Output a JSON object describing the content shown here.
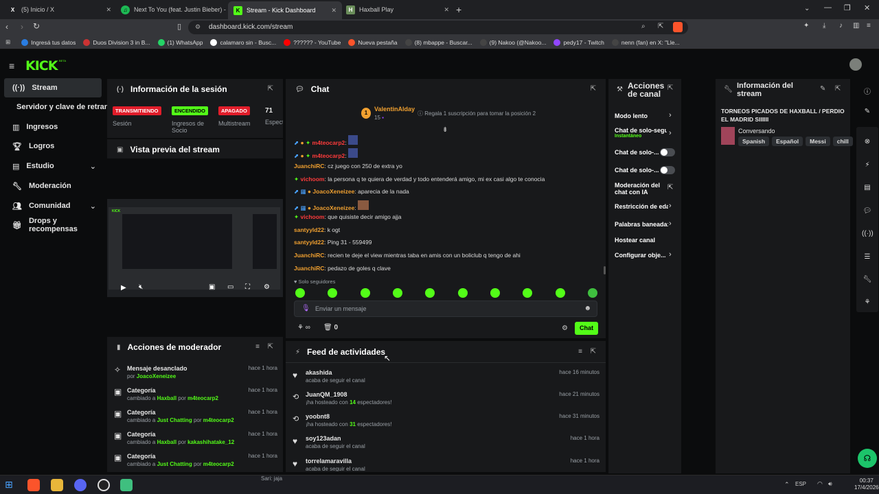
{
  "browser": {
    "tabs": [
      {
        "title": "(5) Inicio / X",
        "icon": "X"
      },
      {
        "title": "Next To You (feat. Justin Bieber) -",
        "icon": "♫"
      },
      {
        "title": "Stream - Kick Dashboard",
        "icon": "K"
      },
      {
        "title": "Haxball Play",
        "icon": "H"
      }
    ],
    "url": "dashboard.kick.com/stream",
    "bookmarks": [
      "Ingresá tus datos",
      "Duos Division 3 in B...",
      "(1) WhatsApp",
      "calamaro sin - Busc...",
      "?????? - YouTube",
      "Nueva pestaña",
      "(8) mbappe - Buscar...",
      "(9) Nakoo (@Nakoo...",
      "pedy17 - Twitch",
      "nenn (fan) en X: \"Lle..."
    ]
  },
  "kick": {
    "logo": "KICK",
    "beta": "BETA"
  },
  "sidebar": {
    "items": [
      {
        "label": "Stream",
        "icon": "broadcast-icon"
      },
      {
        "label": "Servidor y clave de retransm",
        "icon": ""
      },
      {
        "label": "Ingresos",
        "icon": "chart-icon"
      },
      {
        "label": "Logros",
        "icon": "trophy-icon"
      },
      {
        "label": "Estudio",
        "icon": "studio-icon"
      },
      {
        "label": "Moderación",
        "icon": "wrench-icon"
      },
      {
        "label": "Comunidad",
        "icon": "community-icon"
      },
      {
        "label": "Drops y recompensas",
        "icon": "gift-icon"
      }
    ]
  },
  "session": {
    "title": "Información de la sesión",
    "stats": [
      {
        "badge": "TRANSMITIENDO",
        "label": "Sesión",
        "color": "#e11d2a"
      },
      {
        "badge": "ENCENDIDO",
        "label": "Ingresos de Socio",
        "color": "#53fc18"
      },
      {
        "badge": "APAGADO",
        "label": "Multistream",
        "color": "#e11d2a"
      },
      {
        "badge": "71",
        "label": "Espect"
      }
    ]
  },
  "preview": {
    "title": "Vista previa del stream"
  },
  "mod_actions": {
    "title": "Acciones de moderador",
    "items": [
      {
        "action": "Mensaje desanclado",
        "detail_prefix": "por",
        "user": "JoacoXeneizee",
        "category": "",
        "time": "hace 1 hora"
      },
      {
        "action": "Categoría",
        "detail_prefix": "cambiado a",
        "category": "Haxball",
        "by": "por",
        "user": "m4teocarp2",
        "time": "hace 1 hora"
      },
      {
        "action": "Categoría",
        "detail_prefix": "cambiado a",
        "category": "Just Chatting",
        "by": "por",
        "user": "m4teocarp2",
        "time": "hace 1 hora"
      },
      {
        "action": "Categoría",
        "detail_prefix": "cambiado a",
        "category": "Haxball",
        "by": "por",
        "user": "kakashihatake_12",
        "time": "hace 1 hora"
      },
      {
        "action": "Categoría",
        "detail_prefix": "cambiado a",
        "category": "Just Chatting",
        "by": "por",
        "user": "m4teocarp2",
        "time": "hace 1 hora"
      }
    ]
  },
  "chat": {
    "title": "Chat",
    "pinned": {
      "user": "ValentinAlday",
      "count": "15",
      "text": "Regala 1 suscripción para tomar la posición 2"
    },
    "messages": [
      {
        "user": "m4teocarp2",
        "color": "#ff3b3b",
        "text": ""
      },
      {
        "user": "m4teocarp2",
        "color": "#ff3b3b",
        "text": ""
      },
      {
        "user": "JuanchiRC",
        "color": "#f0a030",
        "text": "cz juego con 250 de extra yo"
      },
      {
        "user": "vichoom",
        "color": "#ff3b3b",
        "text": "la persona q te quiera de verdad y todo entenderá amigo, mi ex casi algo te conocia"
      },
      {
        "user": "JoacoXeneizee",
        "color": "#f0a030",
        "text": "aparecia de la nada"
      },
      {
        "user": "JoacoXeneizee",
        "color": "#f0a030",
        "text": ""
      },
      {
        "user": "vichoom",
        "color": "#ff3b3b",
        "text": "que quisiste decir amigo ajja"
      },
      {
        "user": "santyyld22",
        "color": "#f0a030",
        "text": "k ogt"
      },
      {
        "user": "santyyld22",
        "color": "#f0a030",
        "text": "Ping 31 - 559499"
      },
      {
        "user": "JuanchiRC",
        "color": "#f0a030",
        "text": "recien te deje el view mientras taba en amis con un boliclub q tengo de ahi"
      },
      {
        "user": "JuanchiRC",
        "color": "#f0a030",
        "text": "pedazo de goles q clave"
      }
    ],
    "followers_only": "Solo seguidores",
    "placeholder": "Enviar un mensaje",
    "infinite": "∞",
    "points": "0",
    "send": "Chat"
  },
  "feed": {
    "title": "Feed de actividades",
    "items": [
      {
        "user": "akashida",
        "desc": "acaba de seguir el canal",
        "time": "hace 16 minutos",
        "icon": "heart-icon"
      },
      {
        "user": "JuanQM_1908",
        "desc_prefix": "¡ha hosteado con",
        "num": "14",
        "desc_suffix": "espectadores!",
        "time": "hace 21 minutos",
        "icon": "host-icon"
      },
      {
        "user": "yoobnt8",
        "desc_prefix": "¡ha hosteado con",
        "num": "31",
        "desc_suffix": "espectadores!",
        "time": "hace 31 minutos",
        "icon": "host-icon"
      },
      {
        "user": "soy123adan",
        "desc": "acaba de seguir el canal",
        "time": "hace 1 hora",
        "icon": "heart-icon"
      },
      {
        "user": "torrelamaravilla",
        "desc": "acaba de seguir el canal",
        "time": "hace 1 hora",
        "icon": "heart-icon"
      }
    ]
  },
  "channel_actions": {
    "title_l1": "Acciones",
    "title_l2": "de canal",
    "items": [
      {
        "label": "Modo lento",
        "sub": ""
      },
      {
        "label": "Chat de solo-segu",
        "sub": "Instantáneo"
      },
      {
        "label": "Chat de solo-...",
        "sub": ""
      },
      {
        "label": "Chat de solo-...",
        "sub": ""
      },
      {
        "label": "Moderación del chat con IA",
        "sub": ""
      },
      {
        "label": "Restricción de eda",
        "sub": ""
      },
      {
        "label": "Palabras baneada:",
        "sub": ""
      },
      {
        "label": "Hostear canal",
        "sub": ""
      },
      {
        "label": "Configurar obje...",
        "sub": ""
      }
    ]
  },
  "stream_info": {
    "title_l1": "Información del",
    "title_l2": "stream",
    "stream_title": "TORNEOS PICADOS DE HAXBALL / PERDIO EL MADRID SIIIIII",
    "category": "Conversando",
    "tags": [
      "Spanish",
      "Español",
      "Messi",
      "chill"
    ]
  },
  "taskbar": {
    "time": "00:37",
    "date": "17/4/2026",
    "lang": "ESP",
    "video_overlay": "Sari: jaja"
  }
}
